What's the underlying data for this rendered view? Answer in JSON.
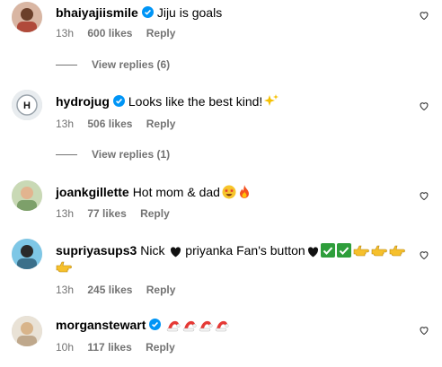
{
  "comments": [
    {
      "username": "bhaiyajiismile",
      "text": "Jiju is goals",
      "time": "13h",
      "likes": "600 likes",
      "reply": "Reply",
      "view_replies": "View replies (6)",
      "verified": true
    },
    {
      "username": "hydrojug",
      "text": "Looks like the best kind!",
      "time": "13h",
      "likes": "506 likes",
      "reply": "Reply",
      "view_replies": "View replies (1)",
      "verified": true
    },
    {
      "username": "joankgillette",
      "text": "Hot mom & dad",
      "time": "13h",
      "likes": "77 likes",
      "reply": "Reply",
      "verified": false
    },
    {
      "username": "supriyasups3",
      "text_part1": "Nick",
      "text_part2": "priyanka Fan's button",
      "time": "13h",
      "likes": "245 likes",
      "reply": "Reply",
      "verified": false
    },
    {
      "username": "morganstewart",
      "time": "10h",
      "likes": "117 likes",
      "reply": "Reply",
      "verified": true
    }
  ],
  "colors": {
    "meta": "#737373",
    "verified": "#0095f6"
  }
}
